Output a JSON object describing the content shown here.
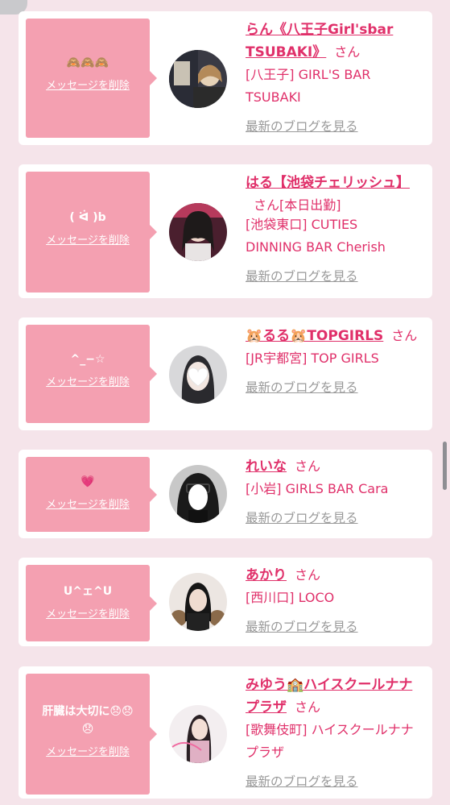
{
  "common": {
    "delete_label": "メッセージを削除",
    "san": "さん",
    "blog_label": "最新のブログを見る"
  },
  "messages": [
    {
      "message": "🙈🙈🙈",
      "name": "らん《八王子Girl'sbar TSUBAKI》",
      "suffix": "",
      "shop": "[八王子] GIRL'S BAR TSUBAKI"
    },
    {
      "message": "( ᐛ )b",
      "name": "はる【池袋チェリッシュ】",
      "suffix": "[本日出勤]",
      "shop": "[池袋東口] CUTIES DINNING BAR Cherish"
    },
    {
      "message": "^_−☆",
      "name": "🐹るる🐹TOPGIRLS",
      "suffix": "",
      "shop": "[JR宇都宮] TOP GIRLS"
    },
    {
      "message": "💗",
      "name": "れいな",
      "suffix": "",
      "shop": "[小岩] GIRLS BAR Cara"
    },
    {
      "message": "U^ェ^U",
      "name": "あかり",
      "suffix": "",
      "shop": "[西川口] LOCO"
    },
    {
      "message": "肝臓は大切に😞😞😞",
      "name": "みゆう🏫ハイスクールナナプラザ",
      "suffix": "",
      "shop": "[歌舞伎町] ハイスクールナナプラザ"
    }
  ]
}
